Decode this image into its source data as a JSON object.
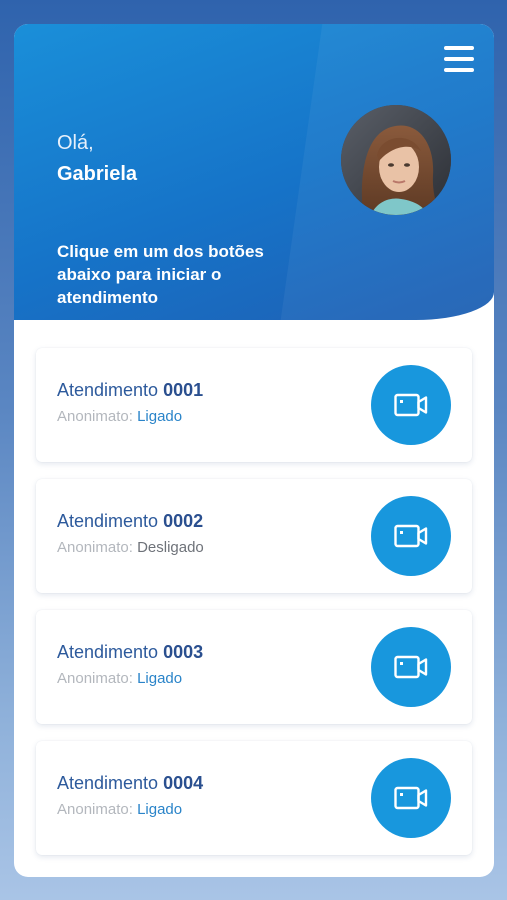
{
  "header": {
    "greeting": "Olá,",
    "user_name": "Gabriela",
    "instruction": "Clique em um dos botões abaixo para iniciar o atendimento",
    "menu_icon": "hamburger-menu-icon",
    "avatar_alt": "Gabriela"
  },
  "calls": [
    {
      "title_prefix": "Atendimento",
      "number": "0001",
      "anonymity_label": "Anonimato:",
      "anonymity_value": "Ligado",
      "icon": "video-camera-icon"
    },
    {
      "title_prefix": "Atendimento",
      "number": "0002",
      "anonymity_label": "Anonimato:",
      "anonymity_value": "Desligado",
      "icon": "video-camera-icon"
    },
    {
      "title_prefix": "Atendimento",
      "number": "0003",
      "anonymity_label": "Anonimato:",
      "anonymity_value": "Ligado",
      "icon": "video-camera-icon"
    },
    {
      "title_prefix": "Atendimento",
      "number": "0004",
      "anonymity_label": "Anonimato:",
      "anonymity_value": "Ligado",
      "icon": "video-camera-icon"
    }
  ],
  "colors": {
    "header_start": "#1a8fd9",
    "header_end": "#1f5fb3",
    "video_button": "#1897dd",
    "status_on": "#2a84c9",
    "status_off": "#6e7279"
  }
}
